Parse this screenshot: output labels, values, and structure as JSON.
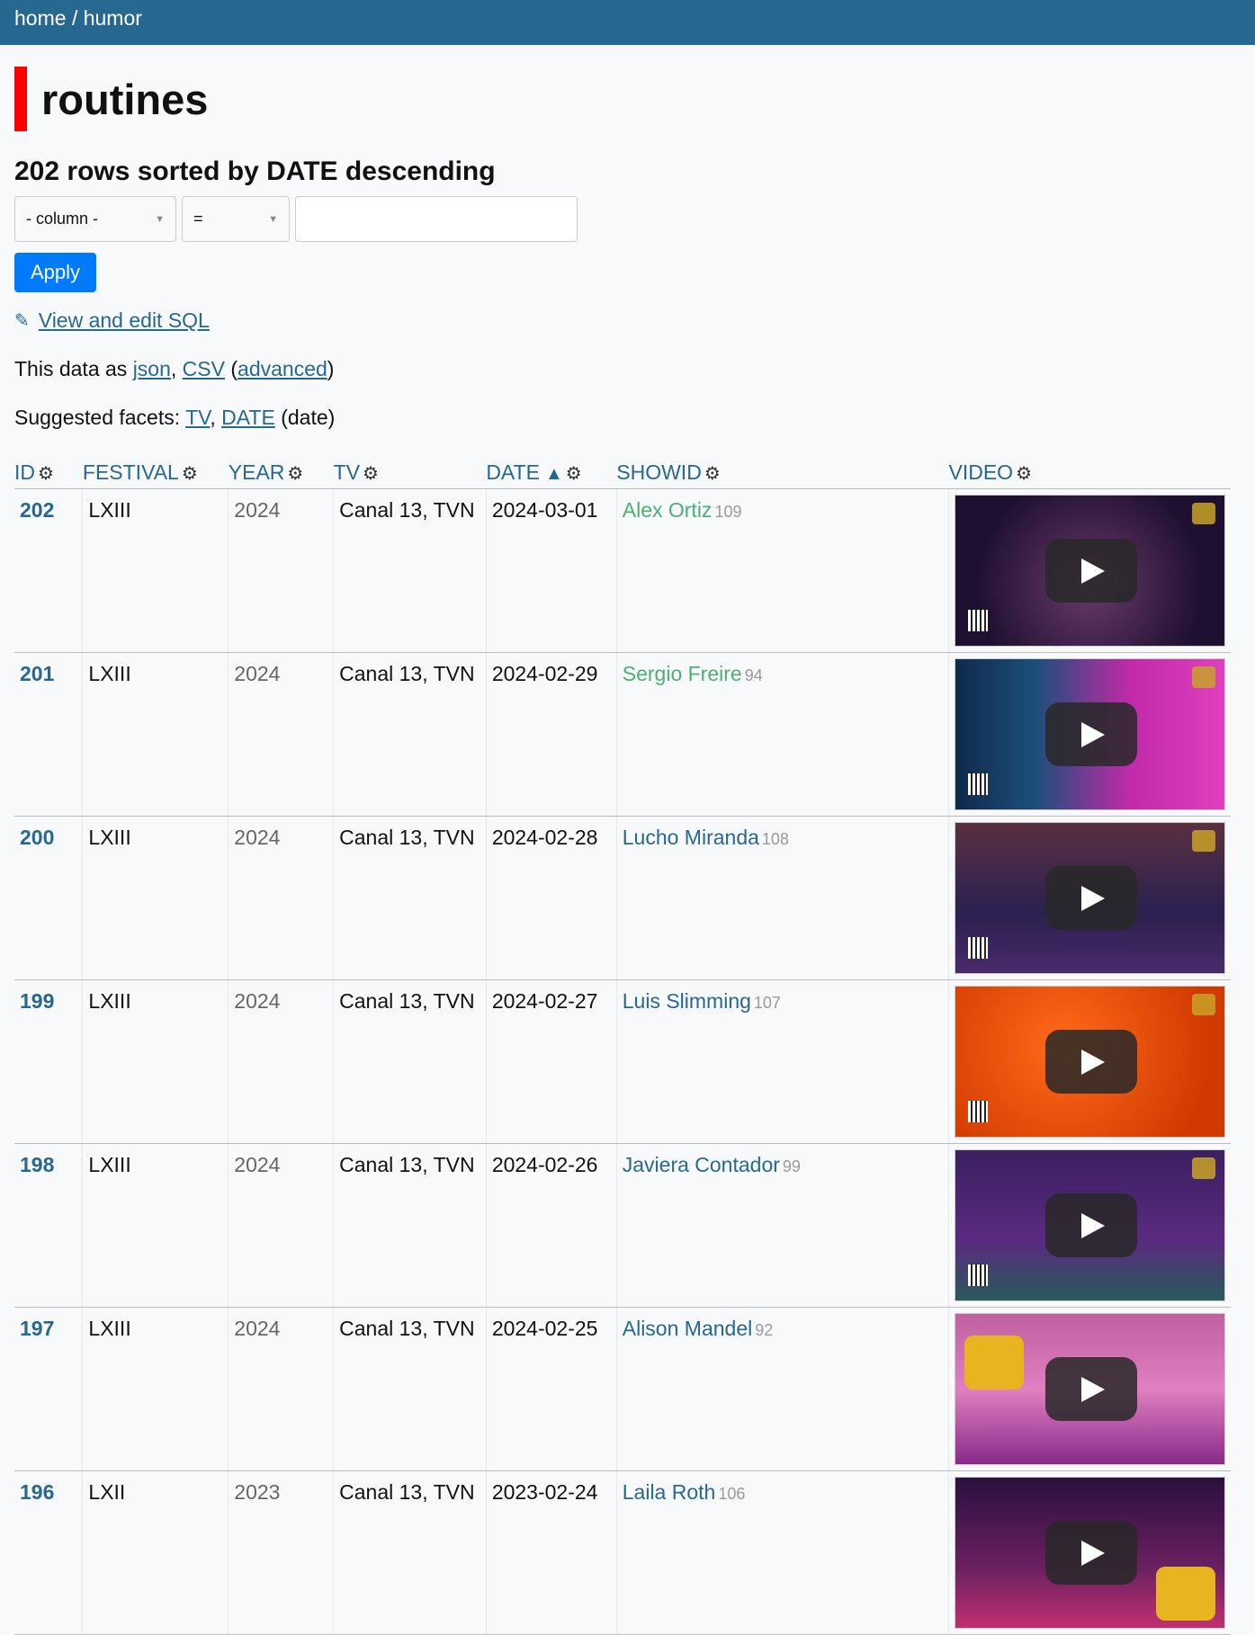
{
  "breadcrumb": {
    "home": "home",
    "sep": "/",
    "section": "humor"
  },
  "page": {
    "title": "routines",
    "subtitle": "202 rows sorted by DATE descending"
  },
  "filter": {
    "column_value": "- column -",
    "operator_value": "=",
    "text_value": "",
    "apply_label": "Apply"
  },
  "links": {
    "view_sql": "View and edit SQL",
    "data_as_prefix": "This data as",
    "json": "json",
    "csv": "CSV",
    "advanced": "advanced",
    "facets_prefix": "Suggested facets:",
    "facet_tv": "TV",
    "facet_date": "DATE",
    "facet_date_suffix": "(date)"
  },
  "table": {
    "columns": [
      "ID",
      "FESTIVAL",
      "YEAR",
      "TV",
      "DATE",
      "SHOWID",
      "VIDEO"
    ],
    "rows": [
      {
        "id": "202",
        "festival": "LXIII",
        "year": "2024",
        "tv": "Canal 13, TVN",
        "date": "2024-03-01",
        "show": "Alex Ortiz",
        "count": "109",
        "color": "#4caf73"
      },
      {
        "id": "201",
        "festival": "LXIII",
        "year": "2024",
        "tv": "Canal 13, TVN",
        "date": "2024-02-29",
        "show": "Sergio Freire",
        "count": "94",
        "color": "#4caf73"
      },
      {
        "id": "200",
        "festival": "LXIII",
        "year": "2024",
        "tv": "Canal 13, TVN",
        "date": "2024-02-28",
        "show": "Lucho Miranda",
        "count": "108",
        "color": "#276890"
      },
      {
        "id": "199",
        "festival": "LXIII",
        "year": "2024",
        "tv": "Canal 13, TVN",
        "date": "2024-02-27",
        "show": "Luis Slimming",
        "count": "107",
        "color": "#276890"
      },
      {
        "id": "198",
        "festival": "LXIII",
        "year": "2024",
        "tv": "Canal 13, TVN",
        "date": "2024-02-26",
        "show": "Javiera Contador",
        "count": "99",
        "color": "#276890"
      },
      {
        "id": "197",
        "festival": "LXIII",
        "year": "2024",
        "tv": "Canal 13, TVN",
        "date": "2024-02-25",
        "show": "Alison Mandel",
        "count": "92",
        "color": "#276890"
      },
      {
        "id": "196",
        "festival": "LXII",
        "year": "2023",
        "tv": "Canal 13, TVN",
        "date": "2023-02-24",
        "show": "Laila Roth",
        "count": "106",
        "color": "#276890"
      }
    ]
  },
  "colors": {
    "topbar": "#276890",
    "accent": "#ff0000",
    "button": "#007bff",
    "link": "#276890"
  },
  "icons": {
    "settings": "gear-icon",
    "sort": "sort-arrow-icon",
    "edit": "pencil-icon",
    "play": "play-icon"
  }
}
